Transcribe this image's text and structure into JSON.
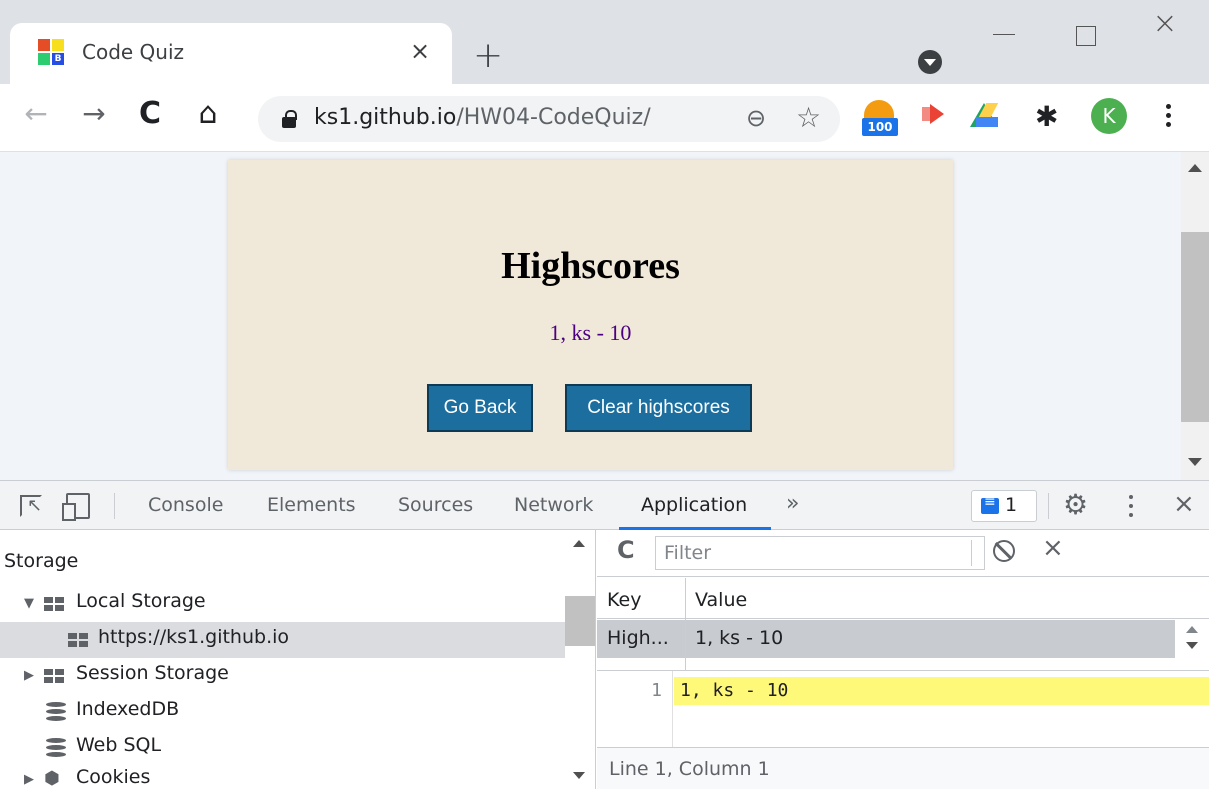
{
  "browser": {
    "tab_title": "Code Quiz",
    "tab_close_glyph": "×",
    "new_tab_glyph": "+",
    "window_close_glyph": "×",
    "url_host": "ks1.github.io",
    "url_path": "/HW04-CodeQuiz/",
    "extension_badge": "100",
    "avatar_letter": "K",
    "back_glyph": "←",
    "forward_glyph": "→",
    "reload_glyph": "C",
    "home_glyph": "⌂",
    "zoom_glyph": "⊖",
    "star_glyph": "☆",
    "puzzle_glyph": "✱"
  },
  "page": {
    "title": "Highscores",
    "score_line": "1, ks - 10",
    "go_back_label": "Go Back",
    "clear_label": "Clear highscores",
    "card_color": "#f0e8d8",
    "button_color": "#1b6e9e",
    "score_color": "#4b0082"
  },
  "devtools": {
    "tabs": [
      {
        "label": "Console"
      },
      {
        "label": "Elements"
      },
      {
        "label": "Sources"
      },
      {
        "label": "Network"
      },
      {
        "label": "Application"
      }
    ],
    "active_tab": "Application",
    "more_glyph": "»",
    "issues_count": "1",
    "gear_glyph": "⚙",
    "close_glyph": "×",
    "sidebar": {
      "header": "Storage",
      "items": [
        {
          "label": "Local Storage",
          "arrow": "▼"
        },
        {
          "label": "https://ks1.github.io"
        },
        {
          "label": "Session Storage",
          "arrow": "▶"
        },
        {
          "label": "IndexedDB"
        },
        {
          "label": "Web SQL"
        },
        {
          "label": "Cookies",
          "arrow": "▶"
        }
      ]
    },
    "storage_view": {
      "refresh_glyph": "C",
      "filter_placeholder": "Filter",
      "clear_glyph": "×",
      "columns": {
        "key": "Key",
        "value": "Value"
      },
      "rows": [
        {
          "key": "High...",
          "value": "1, ks - 10"
        }
      ],
      "preview_line_number": "1",
      "preview_text": "1, ks - 10",
      "status": "Line 1, Column 1"
    },
    "accent_color": "#1a73e8"
  }
}
